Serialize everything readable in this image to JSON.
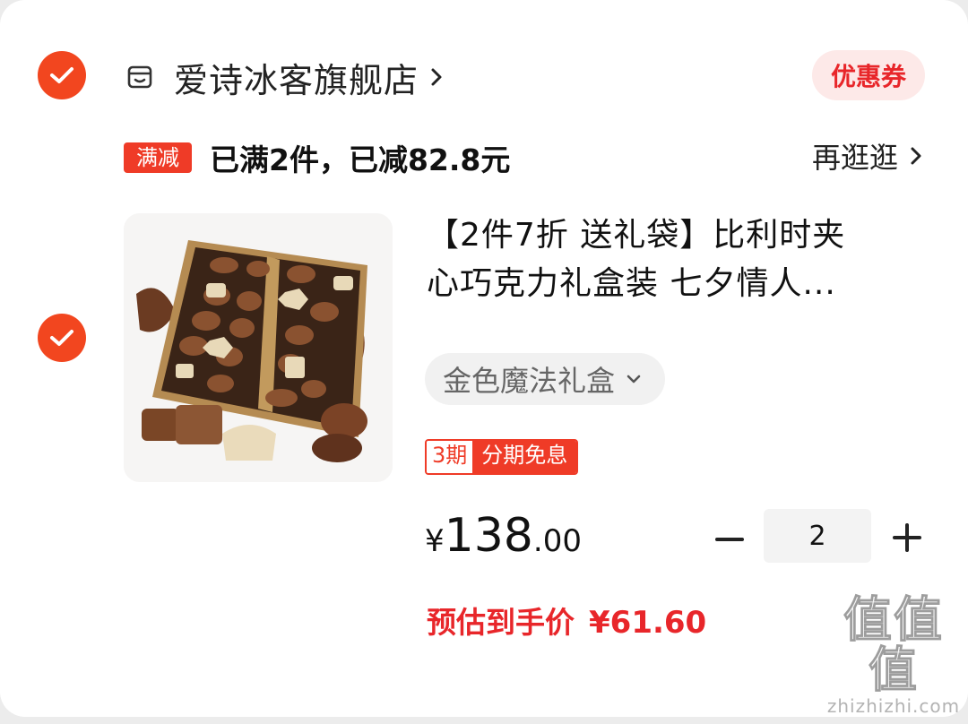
{
  "shop": {
    "name": "爱诗冰客旗舰店",
    "coupon_label": "优惠券",
    "checked": true
  },
  "promo": {
    "tag": "满减",
    "text": "已满2件，已减82.8元",
    "more_label": "再逛逛"
  },
  "product": {
    "checked": true,
    "title_line1": "【2件7折 送礼袋】比利时夹",
    "title_line2": "心巧克力礼盒装 七夕情人...",
    "image_desc": "chocolate-gift-box",
    "variant": "金色魔法礼盒",
    "installment_periods": "3期",
    "installment_label": "分期免息",
    "price_currency": "¥",
    "price_integer": "138",
    "price_decimal": ".00",
    "quantity": "2",
    "estimate_label": "预估到手价",
    "estimate_value": "¥61.60"
  },
  "watermark": {
    "logo_text": "值值值",
    "site": "zhizhizhi.com"
  },
  "colors": {
    "accent": "#f2461f",
    "promo_red": "#ef3b27",
    "price_red": "#e8262a"
  }
}
